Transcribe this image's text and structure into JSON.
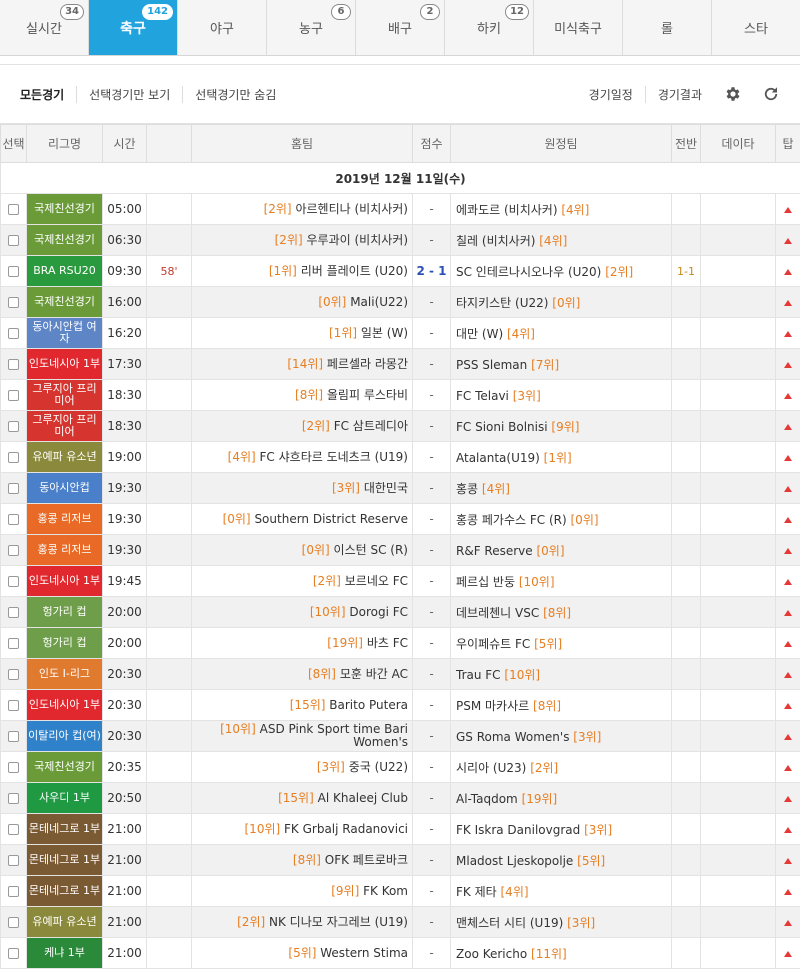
{
  "tabs": [
    {
      "label": "실시간",
      "badge": "34",
      "active": false
    },
    {
      "label": "축구",
      "badge": "142",
      "active": true
    },
    {
      "label": "야구",
      "badge": "",
      "active": false
    },
    {
      "label": "농구",
      "badge": "6",
      "active": false
    },
    {
      "label": "배구",
      "badge": "2",
      "active": false
    },
    {
      "label": "하키",
      "badge": "12",
      "active": false
    },
    {
      "label": "미식축구",
      "badge": "",
      "active": false
    },
    {
      "label": "롤",
      "badge": "",
      "active": false
    },
    {
      "label": "스타",
      "badge": "",
      "active": false
    }
  ],
  "filter": {
    "left": [
      "모든경기",
      "선택경기만 보기",
      "선택경기만 숨김"
    ],
    "right": [
      "경기일정",
      "경기결과"
    ],
    "icons": [
      "gear-icon",
      "refresh-icon"
    ]
  },
  "columns": [
    "선택",
    "리그명",
    "시간",
    "",
    "홈팀",
    "점수",
    "원정팀",
    "전반",
    "데이타",
    "탑"
  ],
  "date": "2019년 12월 11일(수)",
  "colors": {
    "accent": "#21a3de",
    "rank": "#e67e22",
    "live_score": "#2b50b8",
    "tip": "#e53935"
  },
  "matches": [
    {
      "league": "국제친선경기",
      "lc": "#6a9b38",
      "time": "05:00",
      "live": "",
      "home_rank": "[2위]",
      "home": "아르헨티나 (비치사커)",
      "score": "-",
      "away": "에콰도르 (비치사커)",
      "away_rank": "[4위]",
      "half": ""
    },
    {
      "league": "국제친선경기",
      "lc": "#6a9b38",
      "time": "06:30",
      "live": "",
      "home_rank": "[2위]",
      "home": "우루과이 (비치사커)",
      "score": "-",
      "away": "칠레 (비치사커)",
      "away_rank": "[4위]",
      "half": ""
    },
    {
      "league": "BRA RSU20",
      "lc": "#2a9a3e",
      "time": "09:30",
      "live": "58'",
      "home_rank": "[1위]",
      "home": "리버 플레이트 (U20)",
      "score": "2 - 1",
      "away": "SC 인테르나시오나우 (U20)",
      "away_rank": "[2위]",
      "half": "1-1"
    },
    {
      "league": "국제친선경기",
      "lc": "#6a9b38",
      "time": "16:00",
      "live": "",
      "home_rank": "[0위]",
      "home": "Mali(U22)",
      "score": "-",
      "away": "타지키스탄 (U22)",
      "away_rank": "[0위]",
      "half": ""
    },
    {
      "league": "동아시안컵 여자",
      "lc": "#5e86c7",
      "time": "16:20",
      "live": "",
      "home_rank": "[1위]",
      "home": "일본 (W)",
      "score": "-",
      "away": "대만 (W)",
      "away_rank": "[4위]",
      "half": ""
    },
    {
      "league": "인도네시아 1부",
      "lc": "#e0282e",
      "time": "17:30",
      "live": "",
      "home_rank": "[14위]",
      "home": "페르셀라 라몽간",
      "score": "-",
      "away": "PSS Sleman",
      "away_rank": "[7위]",
      "half": ""
    },
    {
      "league": "그루지아 프리미어",
      "lc": "#d6342f",
      "time": "18:30",
      "live": "",
      "home_rank": "[8위]",
      "home": "올림피 루스타비",
      "score": "-",
      "away": "FC Telavi",
      "away_rank": "[3위]",
      "half": ""
    },
    {
      "league": "그루지아 프리미어",
      "lc": "#d6342f",
      "time": "18:30",
      "live": "",
      "home_rank": "[2위]",
      "home": "FC 삼트레디아",
      "score": "-",
      "away": "FC Sioni Bolnisi",
      "away_rank": "[9위]",
      "half": ""
    },
    {
      "league": "유예파 유소년",
      "lc": "#8b8a3c",
      "time": "19:00",
      "live": "",
      "home_rank": "[4위]",
      "home": "FC 샤흐타르 도네츠크 (U19)",
      "score": "-",
      "away": "Atalanta(U19)",
      "away_rank": "[1위]",
      "half": ""
    },
    {
      "league": "동아시안컵",
      "lc": "#4a7fc9",
      "time": "19:30",
      "live": "",
      "home_rank": "[3위]",
      "home": "대한민국",
      "score": "-",
      "away": "홍콩",
      "away_rank": "[4위]",
      "half": ""
    },
    {
      "league": "홍콩 리저브",
      "lc": "#e86a26",
      "time": "19:30",
      "live": "",
      "home_rank": "[0위]",
      "home": "Southern District Reserve",
      "score": "-",
      "away": "홍콩 페가수스 FC (R)",
      "away_rank": "[0위]",
      "half": ""
    },
    {
      "league": "홍콩 리저브",
      "lc": "#e86a26",
      "time": "19:30",
      "live": "",
      "home_rank": "[0위]",
      "home": "이스턴 SC (R)",
      "score": "-",
      "away": "R&F Reserve",
      "away_rank": "[0위]",
      "half": ""
    },
    {
      "league": "인도네시아 1부",
      "lc": "#e0282e",
      "time": "19:45",
      "live": "",
      "home_rank": "[2위]",
      "home": "보르네오 FC",
      "score": "-",
      "away": "페르십 반둥",
      "away_rank": "[10위]",
      "half": ""
    },
    {
      "league": "헝가리 컵",
      "lc": "#6f9e4a",
      "time": "20:00",
      "live": "",
      "home_rank": "[10위]",
      "home": "Dorogi FC",
      "score": "-",
      "away": "데브레첸니 VSC",
      "away_rank": "[8위]",
      "half": ""
    },
    {
      "league": "헝가리 컵",
      "lc": "#6f9e4a",
      "time": "20:00",
      "live": "",
      "home_rank": "[19위]",
      "home": "바츠 FC",
      "score": "-",
      "away": "우이페슈트 FC",
      "away_rank": "[5위]",
      "half": ""
    },
    {
      "league": "인도 I-리그",
      "lc": "#e07a2e",
      "time": "20:30",
      "live": "",
      "home_rank": "[8위]",
      "home": "모훈 바간 AC",
      "score": "-",
      "away": "Trau FC",
      "away_rank": "[10위]",
      "half": ""
    },
    {
      "league": "인도네시아 1부",
      "lc": "#e0282e",
      "time": "20:30",
      "live": "",
      "home_rank": "[15위]",
      "home": "Barito Putera",
      "score": "-",
      "away": "PSM 마카사르",
      "away_rank": "[8위]",
      "half": ""
    },
    {
      "league": "이탈리아 컵(여)",
      "lc": "#2f82c9",
      "time": "20:30",
      "live": "",
      "home_rank": "[10위]",
      "home": "ASD Pink Sport time Bari Women's",
      "score": "-",
      "away": "GS Roma Women's",
      "away_rank": "[3위]",
      "half": ""
    },
    {
      "league": "국제친선경기",
      "lc": "#6a9b38",
      "time": "20:35",
      "live": "",
      "home_rank": "[3위]",
      "home": "중국 (U22)",
      "score": "-",
      "away": "시리아 (U23)",
      "away_rank": "[2위]",
      "half": ""
    },
    {
      "league": "사우디 1부",
      "lc": "#1f9a43",
      "time": "20:50",
      "live": "",
      "home_rank": "[15위]",
      "home": "Al Khaleej Club",
      "score": "-",
      "away": "Al-Taqdom",
      "away_rank": "[19위]",
      "half": ""
    },
    {
      "league": "몬테네그로 1부",
      "lc": "#7a5a33",
      "time": "21:00",
      "live": "",
      "home_rank": "[10위]",
      "home": "FK Grbalj Radanovici",
      "score": "-",
      "away": "FK Iskra Danilovgrad",
      "away_rank": "[3위]",
      "half": ""
    },
    {
      "league": "몬테네그로 1부",
      "lc": "#7a5a33",
      "time": "21:00",
      "live": "",
      "home_rank": "[8위]",
      "home": "OFK 페트로바크",
      "score": "-",
      "away": "Mladost Ljeskopolje",
      "away_rank": "[5위]",
      "half": ""
    },
    {
      "league": "몬테네그로 1부",
      "lc": "#7a5a33",
      "time": "21:00",
      "live": "",
      "home_rank": "[9위]",
      "home": "FK Kom",
      "score": "-",
      "away": "FK 제타",
      "away_rank": "[4위]",
      "half": ""
    },
    {
      "league": "유예파 유소년",
      "lc": "#8b8a3c",
      "time": "21:00",
      "live": "",
      "home_rank": "[2위]",
      "home": "NK 디나모 자그레브 (U19)",
      "score": "-",
      "away": "맨체스터 시티 (U19)",
      "away_rank": "[3위]",
      "half": ""
    },
    {
      "league": "케냐 1부",
      "lc": "#2b8a3a",
      "time": "21:00",
      "live": "",
      "home_rank": "[5위]",
      "home": "Western Stima",
      "score": "-",
      "away": "Zoo Kericho",
      "away_rank": "[11위]",
      "half": ""
    }
  ]
}
